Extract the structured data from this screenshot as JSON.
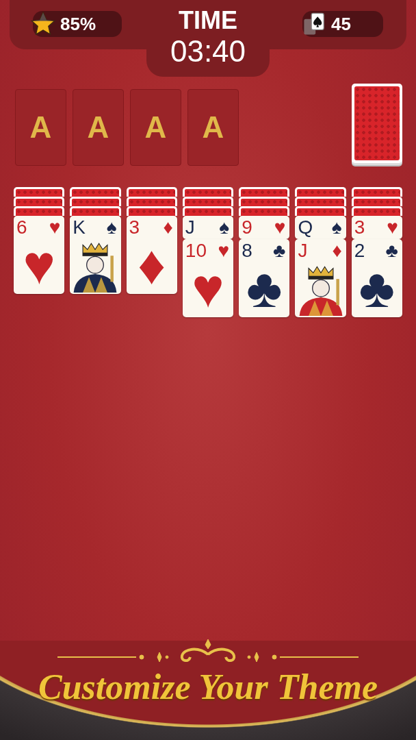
{
  "top_bar": {
    "score": "85%",
    "time_label": "TIME",
    "time": "03:40",
    "moves": "45"
  },
  "foundations": [
    {
      "label": "A"
    },
    {
      "label": "A"
    },
    {
      "label": "A"
    },
    {
      "label": "A"
    }
  ],
  "stock": {
    "face_up": false
  },
  "tableau": [
    {
      "cards": [
        {
          "face_up": false
        },
        {
          "face_up": false
        },
        {
          "face_up": false
        },
        {
          "face_up": true,
          "kind": "pip",
          "rank": "6",
          "suit": "♥",
          "color": "#c8262a"
        }
      ]
    },
    {
      "cards": [
        {
          "face_up": false
        },
        {
          "face_up": false
        },
        {
          "face_up": false
        },
        {
          "face_up": true,
          "kind": "court",
          "rank": "K",
          "suit": "♠",
          "color": "#1c2a4e"
        }
      ]
    },
    {
      "cards": [
        {
          "face_up": false
        },
        {
          "face_up": false
        },
        {
          "face_up": false
        },
        {
          "face_up": true,
          "kind": "pip",
          "rank": "3",
          "suit": "♦",
          "color": "#c8262a"
        }
      ]
    },
    {
      "cards": [
        {
          "face_up": false
        },
        {
          "face_up": false
        },
        {
          "face_up": false
        },
        {
          "face_up": true,
          "rank": "J",
          "suit": "♠",
          "color": "#1c2a4e"
        },
        {
          "face_up": true,
          "kind": "pip",
          "rank": "10",
          "suit": "♥",
          "color": "#c8262a"
        }
      ]
    },
    {
      "cards": [
        {
          "face_up": false
        },
        {
          "face_up": false
        },
        {
          "face_up": false
        },
        {
          "face_up": true,
          "rank": "9",
          "suit": "♥",
          "color": "#c8262a"
        },
        {
          "face_up": true,
          "kind": "pip",
          "rank": "8",
          "suit": "♣",
          "color": "#1c2a4e"
        }
      ]
    },
    {
      "cards": [
        {
          "face_up": false
        },
        {
          "face_up": false
        },
        {
          "face_up": false
        },
        {
          "face_up": true,
          "rank": "Q",
          "suit": "♠",
          "color": "#1c2a4e"
        },
        {
          "face_up": true,
          "kind": "court",
          "rank": "J",
          "suit": "♦",
          "color": "#c8262a"
        }
      ]
    },
    {
      "cards": [
        {
          "face_up": false
        },
        {
          "face_up": false
        },
        {
          "face_up": false
        },
        {
          "face_up": true,
          "rank": "3",
          "suit": "♥",
          "color": "#c8262a"
        },
        {
          "face_up": true,
          "kind": "pip",
          "rank": "2",
          "suit": "♣",
          "color": "#1c2a4e"
        }
      ]
    }
  ],
  "banner": {
    "title": "Customize Your Theme"
  }
}
